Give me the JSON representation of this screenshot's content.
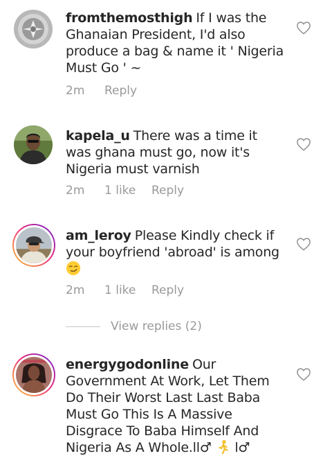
{
  "comments": [
    {
      "username": "fromthemosthigh",
      "text": "If I was the Ghanaian President, I'd also produce a bag & name it ' Nigeria Must Go ' ~",
      "time": "2m",
      "likes": "",
      "reply": "Reply",
      "avatar": "gray-emblem-avatar"
    },
    {
      "username": "kapela_u",
      "text": "There was a time it was ghana must go, now it's Nigeria must varnish",
      "time": "2m",
      "likes": "1 like",
      "reply": "Reply",
      "avatar": "man-avatar"
    },
    {
      "username": "am_leroy",
      "text": "Please Kindly check if your boyfriend 'abroad' is among",
      "emoji": "smirking-face-emoji",
      "time": "2m",
      "likes": "1 like",
      "reply": "Reply",
      "avatar": "cap-man-avatar-story-ring"
    },
    {
      "username": "energygodonline",
      "text": "Our Government At Work, Let Them Do Their Worst Last Last Baba Must Go This Is A Massive Disgrace To Baba Himself And Nigeria As A Whole.",
      "text_suffix": "ll♂",
      "text_suffix2": "l♂",
      "emoji": "person-walking-emoji",
      "avatar": "woman-avatar-story-ring"
    }
  ],
  "view_replies": "View replies (2)",
  "colors": {
    "text": "#262626",
    "meta": "#999999",
    "ring_start": "#f9ce34",
    "ring_mid": "#ee2a7b",
    "ring_end": "#6228d7"
  }
}
